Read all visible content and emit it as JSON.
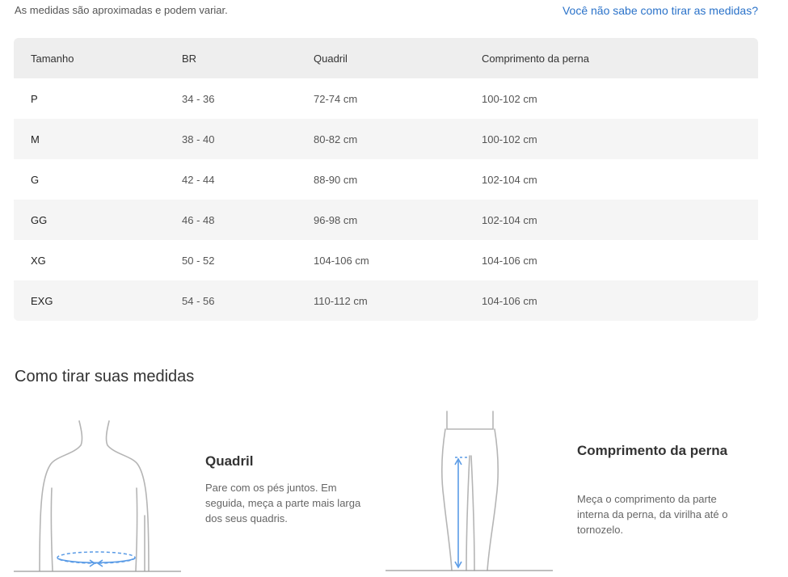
{
  "header": {
    "note": "As medidas são aproximadas e podem variar.",
    "help_link": "Você não sabe como tirar as medidas?"
  },
  "table": {
    "columns": [
      "Tamanho",
      "BR",
      "Quadril",
      "Comprimento da perna"
    ],
    "rows": [
      [
        "P",
        "34 - 36",
        "72-74 cm",
        "100-102 cm"
      ],
      [
        "M",
        "38 - 40",
        "80-82 cm",
        "100-102 cm"
      ],
      [
        "G",
        "42 - 44",
        "88-90 cm",
        "102-104 cm"
      ],
      [
        "GG",
        "46 - 48",
        "96-98 cm",
        "102-104 cm"
      ],
      [
        "XG",
        "50 - 52",
        "104-106 cm",
        "104-106 cm"
      ],
      [
        "EXG",
        "54 - 56",
        "110-112 cm",
        "104-106 cm"
      ]
    ]
  },
  "guide": {
    "title": "Como tirar suas medidas",
    "hip": {
      "title": "Quadril",
      "text": "Pare com os pés juntos. Em seguida, meça a parte mais larga dos seus quadris."
    },
    "leg": {
      "title": "Comprimento da perna",
      "text": "Meça o comprimento da parte interna da perna, da virilha até o tornozelo."
    }
  },
  "colors": {
    "link": "#2a72c9",
    "measure_arrow": "#5a9be6",
    "header_bg": "#eeeeee",
    "alt_row_bg": "#f5f5f5"
  },
  "icons": [
    "torso-illustration",
    "legs-illustration",
    "measure-arrow-icon"
  ]
}
